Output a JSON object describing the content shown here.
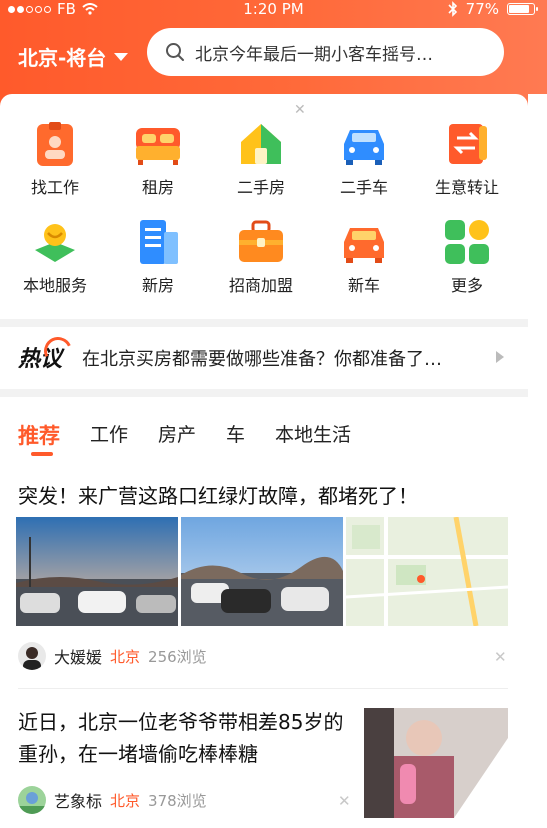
{
  "status_bar": {
    "carrier": "FB",
    "time": "1:20 PM",
    "battery": "77%",
    "battery_level": 0.77
  },
  "header": {
    "city": "北京-将台",
    "search_placeholder": "北京今年最后一期小客车摇号…"
  },
  "services": [
    {
      "label": "找工作",
      "icon": "resume-icon"
    },
    {
      "label": "租房",
      "icon": "bed-icon"
    },
    {
      "label": "二手房",
      "icon": "house-icon"
    },
    {
      "label": "二手车",
      "icon": "car-icon"
    },
    {
      "label": "生意转让",
      "icon": "transfer-icon"
    },
    {
      "label": "本地服务",
      "icon": "local-service-icon"
    },
    {
      "label": "新房",
      "icon": "building-icon"
    },
    {
      "label": "招商加盟",
      "icon": "briefcase-icon"
    },
    {
      "label": "新车",
      "icon": "new-car-icon"
    },
    {
      "label": "更多",
      "icon": "more-grid-icon"
    }
  ],
  "hot": {
    "logo": "热议",
    "text": "在北京买房都需要做哪些准备？你都准备了…"
  },
  "tabs": [
    "推荐",
    "工作",
    "房产",
    "车",
    "本地生活"
  ],
  "feed": [
    {
      "title": "突发！来广营这路口红绿灯故障，都堵死了！",
      "author": "大媛媛",
      "location": "北京",
      "views": "256浏览"
    },
    {
      "title": "近日，北京一位老爷爷带相差85岁的重孙，在一堵墙偷吃棒棒糖",
      "author": "艺象标",
      "location": "北京",
      "views": "378浏览"
    }
  ],
  "colors": {
    "accent": "#ff5a2b",
    "header_start": "#ff5a2b",
    "header_end": "#ff7a52"
  }
}
